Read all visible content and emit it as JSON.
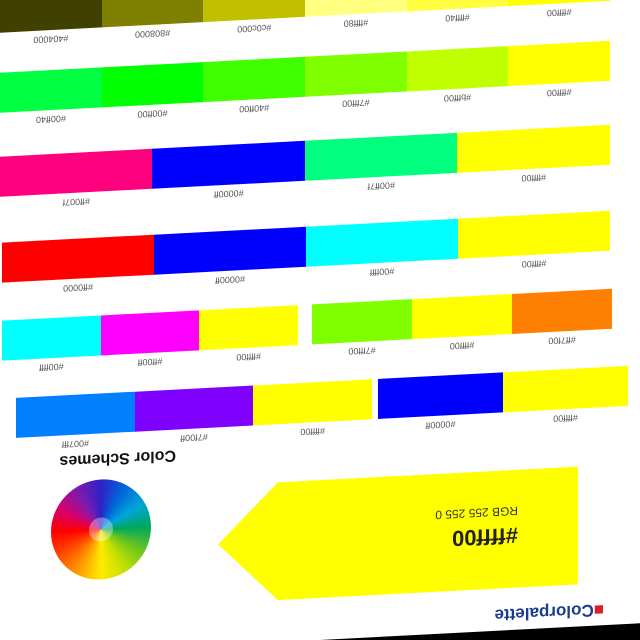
{
  "header": {
    "brand": "Colorpalette",
    "tagline": ""
  },
  "hero": {
    "hex": "#ffff00",
    "rgb": "RGB 255 255 0",
    "schemes_title": "Color Schemes"
  },
  "rows": [
    {
      "caption": "",
      "blocks": [
        {
          "color": "#ffff00",
          "code": "#ffff00"
        },
        {
          "color": "#0000ff",
          "code": "#0000ff"
        }
      ]
    },
    {
      "caption": "",
      "blocks": [
        {
          "color": "#ffff00",
          "code": "#ffff00"
        },
        {
          "color": "#7f00ff",
          "code": "#7f00ff"
        },
        {
          "color": "#007fff",
          "code": "#007fff"
        }
      ]
    },
    {
      "caption": "",
      "blocks": [
        {
          "color": "#ff7f00",
          "code": "#ff7f00"
        },
        {
          "color": "#ffff00",
          "code": "#ffff00"
        },
        {
          "color": "#7fff00",
          "code": "#7fff00"
        }
      ]
    },
    {
      "caption": "",
      "blocks": [
        {
          "color": "#ffff00",
          "code": "#ffff00"
        },
        {
          "color": "#ff00ff",
          "code": "#ff00ff"
        },
        {
          "color": "#00ffff",
          "code": "#00ffff"
        }
      ]
    },
    {
      "caption": "",
      "blocks": [
        {
          "color": "#ffff00",
          "code": "#ffff00"
        },
        {
          "color": "#00ffff",
          "code": "#00ffff"
        },
        {
          "color": "#0000ff",
          "code": "#0000ff"
        },
        {
          "color": "#ff0000",
          "code": "#ff0000"
        }
      ]
    },
    {
      "caption": "",
      "blocks": [
        {
          "color": "#ffff00",
          "code": "#ffff00"
        },
        {
          "color": "#00ff7f",
          "code": "#00ff7f"
        },
        {
          "color": "#0000ff",
          "code": "#0000ff"
        },
        {
          "color": "#ff007f",
          "code": "#ff007f"
        }
      ]
    },
    {
      "caption": "",
      "blocks": [
        {
          "color": "#ffff00",
          "code": "#ffff00"
        },
        {
          "color": "#bfff00",
          "code": "#bfff00"
        },
        {
          "color": "#7fff00",
          "code": "#7fff00"
        },
        {
          "color": "#40ff00",
          "code": "#40ff00"
        },
        {
          "color": "#00ff00",
          "code": "#00ff00"
        },
        {
          "color": "#00ff40",
          "code": "#00ff40"
        }
      ]
    },
    {
      "caption": "",
      "blocks": [
        {
          "color": "#ffff00",
          "code": "#ffff00"
        },
        {
          "color": "#ffff40",
          "code": "#ffff40"
        },
        {
          "color": "#ffff80",
          "code": "#ffff80"
        },
        {
          "color": "#c0c000",
          "code": "#c0c000"
        },
        {
          "color": "#808000",
          "code": "#808000"
        },
        {
          "color": "#404000",
          "code": "#404000"
        }
      ]
    }
  ]
}
